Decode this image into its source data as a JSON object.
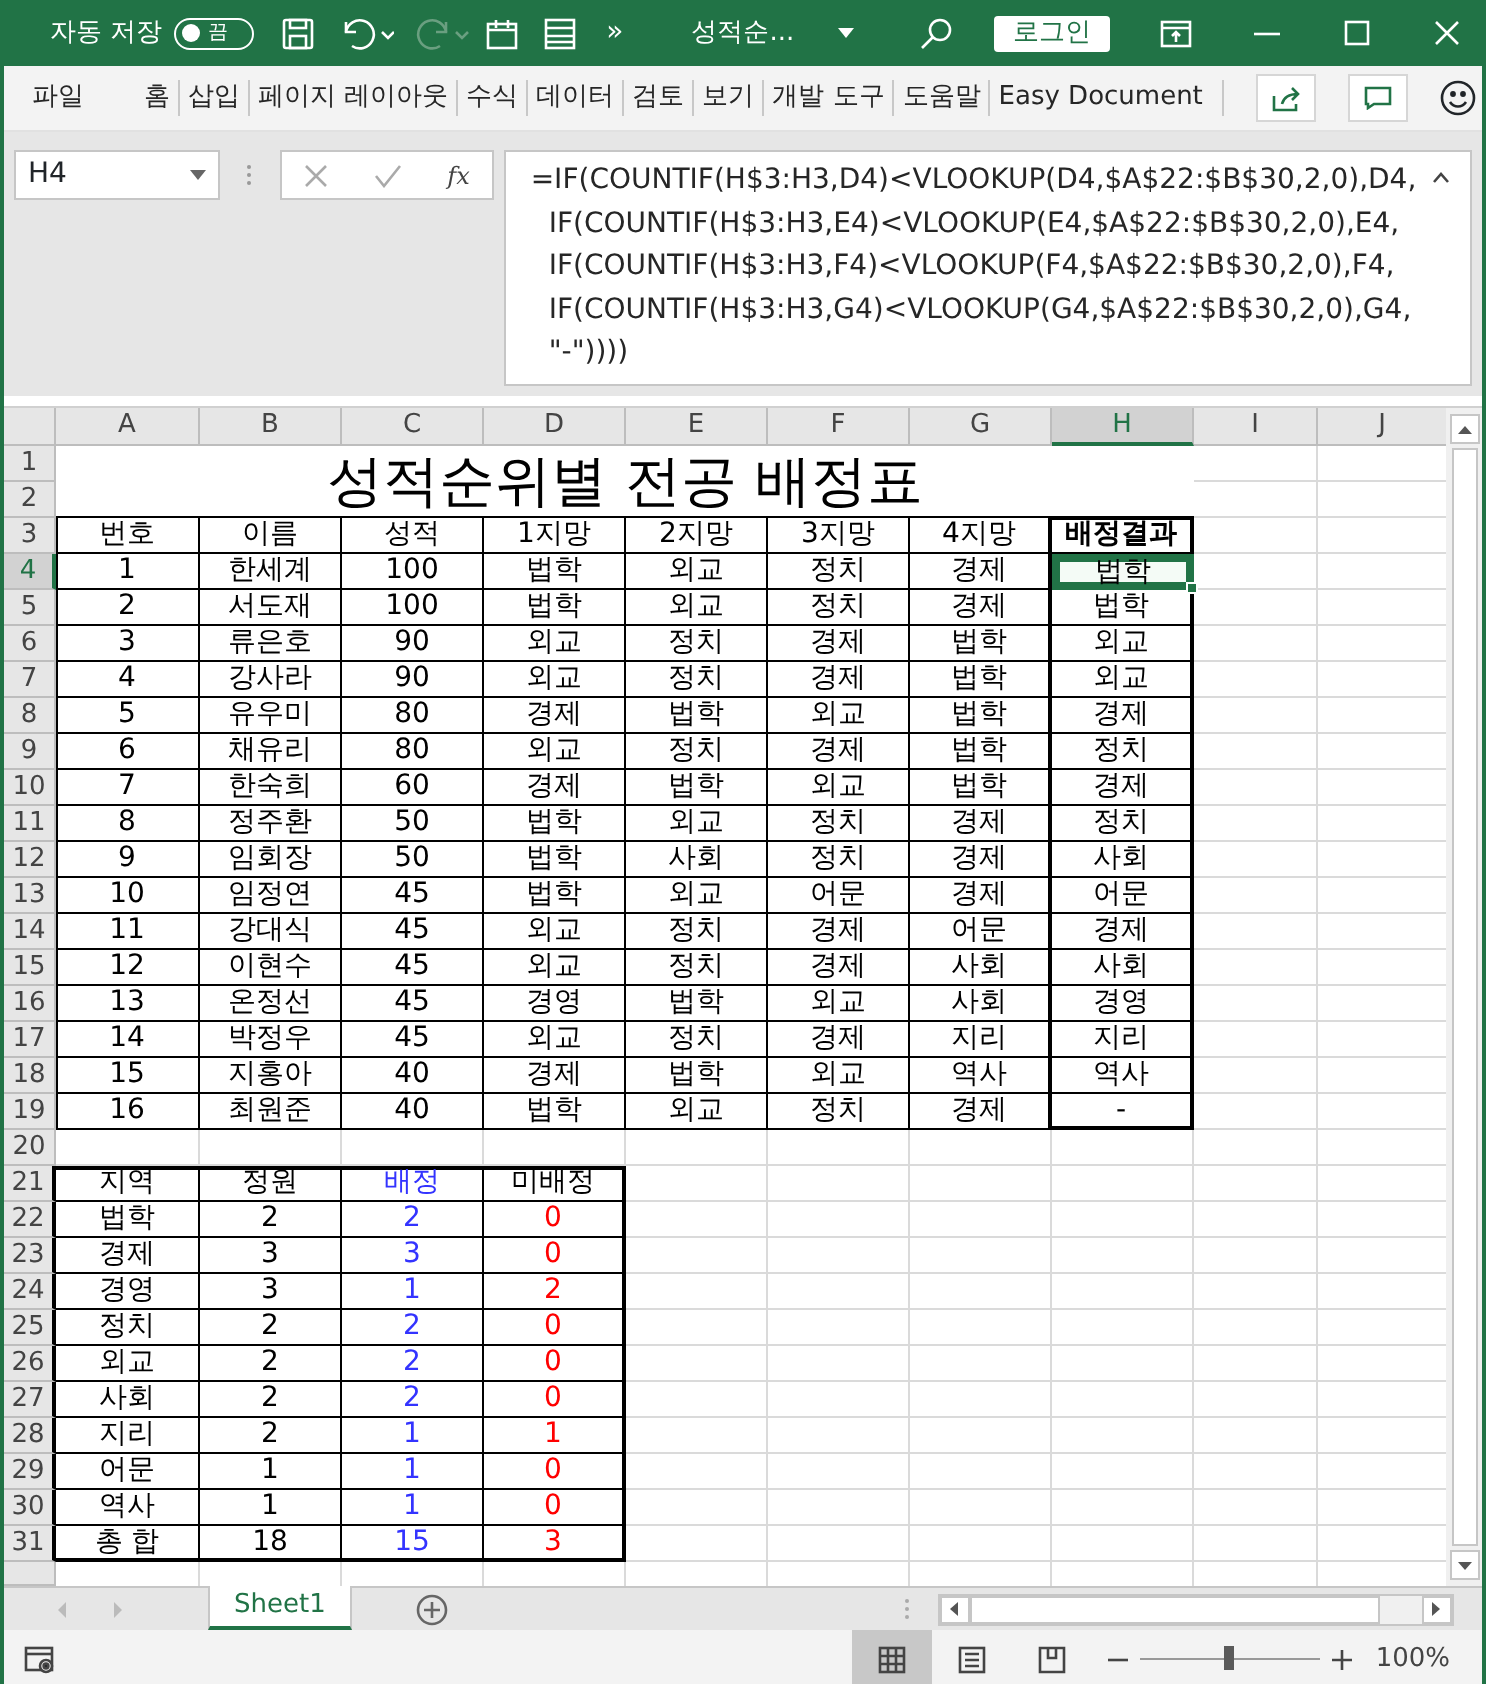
{
  "title_bar": {
    "autosave": {
      "label": "자동 저장",
      "toggle_text": "끔",
      "on": false
    },
    "overflow": "»",
    "file_name": "성적순...",
    "login": "로그인"
  },
  "ribbon_tabs": [
    {
      "label": "파일",
      "selected": false
    },
    {
      "label": "홈",
      "selected": false
    },
    {
      "label": "삽입",
      "selected": false
    },
    {
      "label": "페이지 레이아웃",
      "selected": false
    },
    {
      "label": "수식",
      "selected": false
    },
    {
      "label": "데이터",
      "selected": false
    },
    {
      "label": "검토",
      "selected": false
    },
    {
      "label": "보기",
      "selected": false
    },
    {
      "label": "개발 도구",
      "selected": false
    },
    {
      "label": "도움말",
      "selected": false
    },
    {
      "label": "Easy Document",
      "selected": false
    }
  ],
  "formula_bar": {
    "name_box": "H4",
    "function_label": "fx",
    "formula_lines": [
      "=IF(COUNTIF(H$3:H3,D4)<VLOOKUP(D4,$A$22:$B$30,2,0),D4,",
      "IF(COUNTIF(H$3:H3,E4)<VLOOKUP(E4,$A$22:$B$30,2,0),E4,",
      "IF(COUNTIF(H$3:H3,F4)<VLOOKUP(F4,$A$22:$B$30,2,0),F4,",
      "IF(COUNTIF(H$3:H3,G4)<VLOOKUP(G4,$A$22:$B$30,2,0),G4,",
      "\"-\"))))"
    ]
  },
  "sheet": {
    "columns": [
      {
        "label": "A",
        "selected": false
      },
      {
        "label": "B",
        "selected": false
      },
      {
        "label": "C",
        "selected": false
      },
      {
        "label": "D",
        "selected": false
      },
      {
        "label": "E",
        "selected": false
      },
      {
        "label": "F",
        "selected": false
      },
      {
        "label": "G",
        "selected": false
      },
      {
        "label": "H",
        "selected": true
      },
      {
        "label": "I",
        "selected": false
      },
      {
        "label": "J",
        "selected": false
      }
    ],
    "rows": [
      {
        "label": "1",
        "selected": false
      },
      {
        "label": "2",
        "selected": false
      },
      {
        "label": "3",
        "selected": false
      },
      {
        "label": "4",
        "selected": true
      },
      {
        "label": "5",
        "selected": false
      },
      {
        "label": "6",
        "selected": false
      },
      {
        "label": "7",
        "selected": false
      },
      {
        "label": "8",
        "selected": false
      },
      {
        "label": "9",
        "selected": false
      },
      {
        "label": "10",
        "selected": false
      },
      {
        "label": "11",
        "selected": false
      },
      {
        "label": "12",
        "selected": false
      },
      {
        "label": "13",
        "selected": false
      },
      {
        "label": "14",
        "selected": false
      },
      {
        "label": "15",
        "selected": false
      },
      {
        "label": "16",
        "selected": false
      },
      {
        "label": "17",
        "selected": false
      },
      {
        "label": "18",
        "selected": false
      },
      {
        "label": "19",
        "selected": false
      },
      {
        "label": "20",
        "selected": false
      },
      {
        "label": "21",
        "selected": false
      },
      {
        "label": "22",
        "selected": false
      },
      {
        "label": "23",
        "selected": false
      },
      {
        "label": "24",
        "selected": false
      },
      {
        "label": "25",
        "selected": false
      },
      {
        "label": "26",
        "selected": false
      },
      {
        "label": "27",
        "selected": false
      },
      {
        "label": "28",
        "selected": false
      },
      {
        "label": "29",
        "selected": false
      },
      {
        "label": "30",
        "selected": false
      },
      {
        "label": "31",
        "selected": false
      }
    ],
    "title": "성적순위별 전공 배정표",
    "main_table": {
      "headers": [
        {
          "label": "번호",
          "emphasis": false
        },
        {
          "label": "이름",
          "emphasis": false
        },
        {
          "label": "성적",
          "emphasis": false
        },
        {
          "label": "1지망",
          "emphasis": false
        },
        {
          "label": "2지망",
          "emphasis": false
        },
        {
          "label": "3지망",
          "emphasis": false
        },
        {
          "label": "4지망",
          "emphasis": false
        },
        {
          "label": "배정결과",
          "emphasis": true
        }
      ],
      "rows": [
        {
          "cells": [
            "1",
            "한세계",
            "100",
            "법학",
            "외교",
            "정치",
            "경제",
            "법학"
          ],
          "result_selected": true
        },
        {
          "cells": [
            "2",
            "서도재",
            "100",
            "법학",
            "외교",
            "정치",
            "경제",
            "법학"
          ],
          "result_selected": false
        },
        {
          "cells": [
            "3",
            "류은호",
            "90",
            "외교",
            "정치",
            "경제",
            "법학",
            "외교"
          ],
          "result_selected": false
        },
        {
          "cells": [
            "4",
            "강사라",
            "90",
            "외교",
            "정치",
            "경제",
            "법학",
            "외교"
          ],
          "result_selected": false
        },
        {
          "cells": [
            "5",
            "유우미",
            "80",
            "경제",
            "법학",
            "외교",
            "법학",
            "경제"
          ],
          "result_selected": false
        },
        {
          "cells": [
            "6",
            "채유리",
            "80",
            "외교",
            "정치",
            "경제",
            "법학",
            "정치"
          ],
          "result_selected": false
        },
        {
          "cells": [
            "7",
            "한숙희",
            "60",
            "경제",
            "법학",
            "외교",
            "법학",
            "경제"
          ],
          "result_selected": false
        },
        {
          "cells": [
            "8",
            "정주환",
            "50",
            "법학",
            "외교",
            "정치",
            "경제",
            "정치"
          ],
          "result_selected": false
        },
        {
          "cells": [
            "9",
            "임회장",
            "50",
            "법학",
            "사회",
            "정치",
            "경제",
            "사회"
          ],
          "result_selected": false
        },
        {
          "cells": [
            "10",
            "임정연",
            "45",
            "법학",
            "외교",
            "어문",
            "경제",
            "어문"
          ],
          "result_selected": false
        },
        {
          "cells": [
            "11",
            "강대식",
            "45",
            "외교",
            "정치",
            "경제",
            "어문",
            "경제"
          ],
          "result_selected": false
        },
        {
          "cells": [
            "12",
            "이현수",
            "45",
            "외교",
            "정치",
            "경제",
            "사회",
            "사회"
          ],
          "result_selected": false
        },
        {
          "cells": [
            "13",
            "온정선",
            "45",
            "경영",
            "법학",
            "외교",
            "사회",
            "경영"
          ],
          "result_selected": false
        },
        {
          "cells": [
            "14",
            "박정우",
            "45",
            "외교",
            "정치",
            "경제",
            "지리",
            "지리"
          ],
          "result_selected": false
        },
        {
          "cells": [
            "15",
            "지홍아",
            "40",
            "경제",
            "법학",
            "외교",
            "역사",
            "역사"
          ],
          "result_selected": false
        },
        {
          "cells": [
            "16",
            "최원준",
            "40",
            "법학",
            "외교",
            "정치",
            "경제",
            "-"
          ],
          "result_selected": false
        }
      ]
    },
    "summary_table": {
      "columns": [
        {
          "label": "지역"
        },
        {
          "label": "정원"
        },
        {
          "label": "배정",
          "color": "#3333ff"
        },
        {
          "label": "미배정"
        }
      ],
      "rows": [
        [
          {
            "text": "법학"
          },
          {
            "text": "2"
          },
          {
            "text": "2",
            "color": "#3333ff"
          },
          {
            "text": "0",
            "color": "#ff0000"
          }
        ],
        [
          {
            "text": "경제"
          },
          {
            "text": "3"
          },
          {
            "text": "3",
            "color": "#3333ff"
          },
          {
            "text": "0",
            "color": "#ff0000"
          }
        ],
        [
          {
            "text": "경영"
          },
          {
            "text": "3"
          },
          {
            "text": "1",
            "color": "#3333ff"
          },
          {
            "text": "2",
            "color": "#ff0000"
          }
        ],
        [
          {
            "text": "정치"
          },
          {
            "text": "2"
          },
          {
            "text": "2",
            "color": "#3333ff"
          },
          {
            "text": "0",
            "color": "#ff0000"
          }
        ],
        [
          {
            "text": "외교"
          },
          {
            "text": "2"
          },
          {
            "text": "2",
            "color": "#3333ff"
          },
          {
            "text": "0",
            "color": "#ff0000"
          }
        ],
        [
          {
            "text": "사회"
          },
          {
            "text": "2"
          },
          {
            "text": "2",
            "color": "#3333ff"
          },
          {
            "text": "0",
            "color": "#ff0000"
          }
        ],
        [
          {
            "text": "지리"
          },
          {
            "text": "2"
          },
          {
            "text": "1",
            "color": "#3333ff"
          },
          {
            "text": "1",
            "color": "#ff0000"
          }
        ],
        [
          {
            "text": "어문"
          },
          {
            "text": "1"
          },
          {
            "text": "1",
            "color": "#3333ff"
          },
          {
            "text": "0",
            "color": "#ff0000"
          }
        ],
        [
          {
            "text": "역사"
          },
          {
            "text": "1"
          },
          {
            "text": "1",
            "color": "#3333ff"
          },
          {
            "text": "0",
            "color": "#ff0000"
          }
        ],
        [
          {
            "text": "총 합"
          },
          {
            "text": "18"
          },
          {
            "text": "15",
            "color": "#3333ff"
          },
          {
            "text": "3",
            "color": "#ff0000"
          }
        ]
      ]
    },
    "sheet_tabs": [
      {
        "label": "Sheet1",
        "selected": true
      }
    ]
  },
  "status_bar": {
    "views": [
      {
        "kind": "normal",
        "selected": true
      },
      {
        "kind": "page-layout",
        "selected": false
      },
      {
        "kind": "page-break",
        "selected": false
      }
    ],
    "zoom": {
      "level": 0.5,
      "reading": "100%"
    }
  }
}
